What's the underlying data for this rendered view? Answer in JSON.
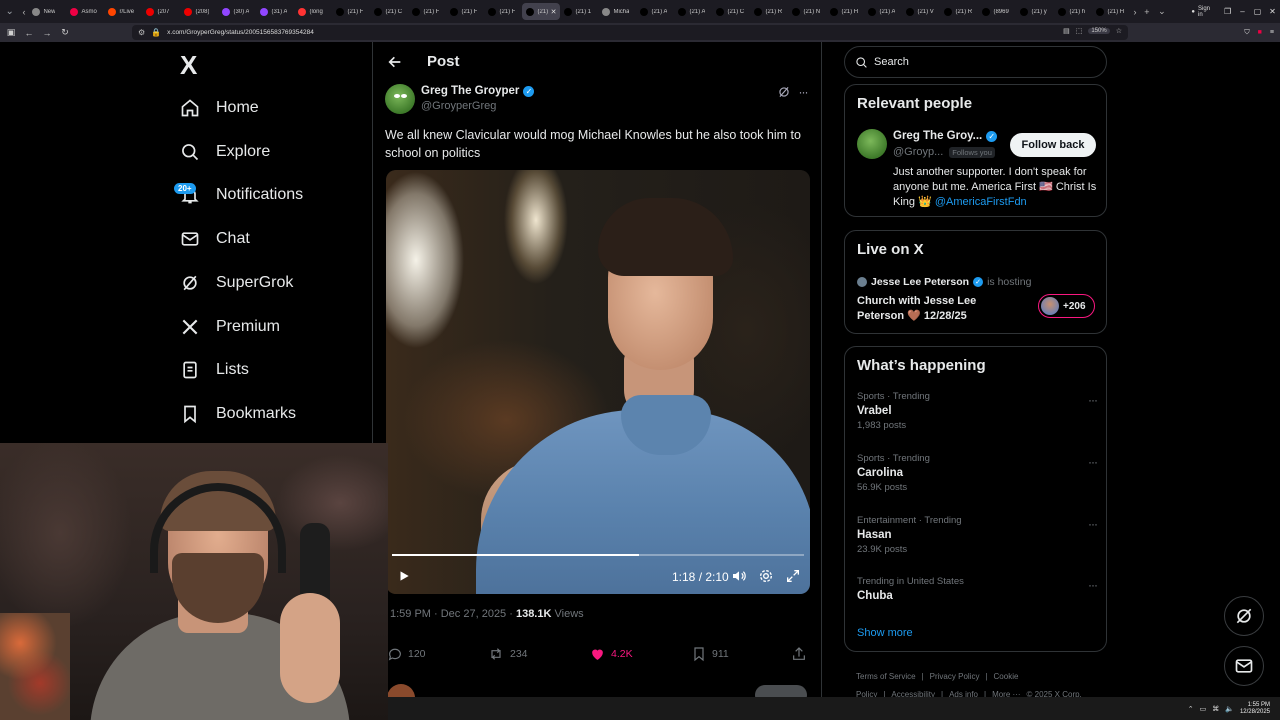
{
  "browser": {
    "tabs": [
      {
        "label": "New",
        "color": "#888"
      },
      {
        "label": "Asmo",
        "color": "#e04"
      },
      {
        "label": "r/Live",
        "color": "#ff4500"
      },
      {
        "label": "(207",
        "color": "#e00"
      },
      {
        "label": "(208)",
        "color": "#e00"
      },
      {
        "label": "(30) A",
        "color": "#9146ff"
      },
      {
        "label": "(31) A",
        "color": "#9146ff"
      },
      {
        "label": "(long",
        "color": "#f33"
      },
      {
        "label": "(21) F",
        "color": "#000"
      },
      {
        "label": "(21) C",
        "color": "#000"
      },
      {
        "label": "(21) F",
        "color": "#000"
      },
      {
        "label": "(21) F",
        "color": "#000"
      },
      {
        "label": "(21) F",
        "color": "#000"
      },
      {
        "label": "(21) A",
        "color": "#000"
      },
      {
        "label": "(21) 1",
        "color": "#000"
      },
      {
        "label": "Micha",
        "color": "#888"
      },
      {
        "label": "(21) A",
        "color": "#000"
      },
      {
        "label": "(21) A",
        "color": "#000"
      },
      {
        "label": "(21) C",
        "color": "#000"
      },
      {
        "label": "(21) R",
        "color": "#000"
      },
      {
        "label": "(21) N",
        "color": "#000"
      },
      {
        "label": "(21) H",
        "color": "#000"
      },
      {
        "label": "(21) A",
        "color": "#000"
      },
      {
        "label": "(21) V",
        "color": "#000"
      },
      {
        "label": "(21) R",
        "color": "#000"
      },
      {
        "label": "(8969",
        "color": "#000"
      },
      {
        "label": "(21) y",
        "color": "#000"
      },
      {
        "label": "(21) h",
        "color": "#000"
      },
      {
        "label": "(21) H",
        "color": "#000"
      }
    ],
    "active_tab_index": 13,
    "url": "x.com/GroyperGreg/status/2005156583769354284",
    "zoom": "150%",
    "sign_in": "Sign in"
  },
  "nav": {
    "logo": "X",
    "items": [
      {
        "label": "Home",
        "icon": "home-icon"
      },
      {
        "label": "Explore",
        "icon": "search-icon"
      },
      {
        "label": "Notifications",
        "icon": "bell-icon",
        "badge": "20+"
      },
      {
        "label": "Chat",
        "icon": "mail-icon"
      },
      {
        "label": "SuperGrok",
        "icon": "grok-icon"
      },
      {
        "label": "Premium",
        "icon": "x-icon"
      },
      {
        "label": "Lists",
        "icon": "list-icon"
      },
      {
        "label": "Bookmarks",
        "icon": "bookmark-icon"
      }
    ]
  },
  "post": {
    "header_title": "Post",
    "author_name": "Greg The Groyper",
    "author_handle": "@GroyperGreg",
    "text": "We all knew Clavicular would mog Michael Knowles but he also took him to school on politics",
    "video": {
      "time": "1:18 / 2:10",
      "progress": 0.6
    },
    "timestamp": "1:59 PM · Dec 27, 2025 · ",
    "views_count": "138.1K",
    "views_label": " Views",
    "actions": {
      "replies": "120",
      "reposts": "234",
      "likes": "4.2K",
      "bookmarks": "911"
    }
  },
  "right": {
    "search_placeholder": "Search",
    "relevant_people": {
      "title": "Relevant people",
      "name": "Greg The Groy...",
      "handle": "@Groyp...",
      "follows_you": "Follows you",
      "follow_button": "Follow back",
      "bio": "Just another supporter. I don't speak for anyone but me. America First 🇺🇸 Christ Is King 👑 ",
      "bio_mention": "@AmericaFirstFdn"
    },
    "live": {
      "title": "Live on X",
      "host": "Jesse Lee Peterson",
      "hosting": "is hosting",
      "space_title": "Church with Jesse Lee Peterson 🤎 12/28/25",
      "listeners": "+206"
    },
    "happening": {
      "title": "What’s happening",
      "trends": [
        {
          "category": "Sports · Trending",
          "name": "Vrabel",
          "posts": "1,983 posts"
        },
        {
          "category": "Sports · Trending",
          "name": "Carolina",
          "posts": "56.9K posts"
        },
        {
          "category": "Entertainment · Trending",
          "name": "Hasan",
          "posts": "23.9K posts"
        },
        {
          "category": "Trending in United States",
          "name": "Chuba",
          "posts": ""
        }
      ],
      "show_more": "Show more"
    },
    "footer": [
      "Terms of Service",
      "|",
      "Privacy Policy",
      "|",
      "Cookie Policy",
      "|",
      "Accessibility",
      "|",
      "Ads info",
      "|",
      "More ···",
      "© 2025 X Corp."
    ]
  },
  "taskbar": {
    "time": "1:55 PM",
    "date": "12/28/2025"
  },
  "colors": {
    "accent": "#1d9bf0",
    "like": "#f91880",
    "border": "#2f3336",
    "muted": "#71767b"
  }
}
